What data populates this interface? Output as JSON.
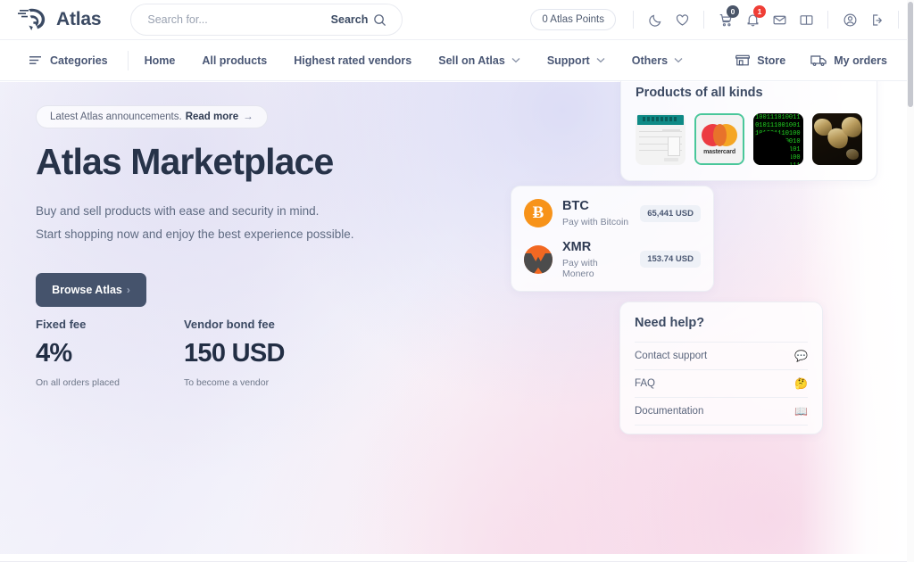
{
  "header": {
    "brand": "Atlas",
    "logo_icon": "eagle-head-logo",
    "search": {
      "placeholder": "Search for...",
      "value": "",
      "button_label": "Search",
      "icon": "search-icon"
    },
    "points_pill": "0 Atlas Points",
    "icons": [
      {
        "name": "dark-mode-icon",
        "glyph": "moon"
      },
      {
        "name": "wishlist-icon",
        "glyph": "heart"
      },
      {
        "name": "cart-icon",
        "glyph": "cart",
        "badge": "0",
        "badge_color": "#4a5568"
      },
      {
        "name": "notifications-icon",
        "glyph": "bell",
        "badge": "1",
        "badge_color": "#ef3e36"
      },
      {
        "name": "messages-icon",
        "glyph": "envelope"
      },
      {
        "name": "guides-icon",
        "glyph": "book"
      },
      {
        "name": "account-icon",
        "glyph": "user-circle"
      },
      {
        "name": "logout-icon",
        "glyph": "logout"
      }
    ]
  },
  "nav": {
    "categories": "Categories",
    "items": [
      {
        "label": "Home",
        "caret": false
      },
      {
        "label": "All products",
        "caret": false
      },
      {
        "label": "Highest rated vendors",
        "caret": false
      },
      {
        "label": "Sell on Atlas",
        "caret": true
      },
      {
        "label": "Support",
        "caret": true
      },
      {
        "label": "Others",
        "caret": true
      }
    ],
    "right": [
      {
        "label": "Store",
        "icon": "storefront-icon"
      },
      {
        "label": "My orders",
        "icon": "delivery-truck-icon"
      }
    ]
  },
  "hero": {
    "announcement": {
      "text": "Latest Atlas announcements.",
      "link": "Read more",
      "arrow": "→"
    },
    "title": "Atlas Marketplace",
    "line1": "Buy and sell products with ease and security in mind.",
    "line2": "Start shopping now and enjoy the best experience possible.",
    "cta": "Browse Atlas",
    "cta_arrow": "›"
  },
  "stats": [
    {
      "label": "Fixed fee",
      "value": "4%",
      "note": "On all orders placed"
    },
    {
      "label": "Vendor bond fee",
      "value": "150 USD",
      "note": "To become a vendor"
    }
  ],
  "products_card": {
    "title": "Products of all kinds",
    "thumbs": [
      {
        "name": "thumb-document",
        "alt": "scanned document form with teal header"
      },
      {
        "name": "thumb-mastercard",
        "alt": "mastercard logo",
        "caption": "mastercard"
      },
      {
        "name": "thumb-matrix-code",
        "alt": "green matrix binary code with hooded figure"
      },
      {
        "name": "thumb-gold-nuggets",
        "alt": "gold nuggets on dark background"
      }
    ],
    "matrix_code": "1001110100110101110010011010011101001101011100100110100111010011010111001001101001110100110101110010011010011101001101011100"
  },
  "crypto_card": {
    "rows": [
      {
        "symbol": "BTC",
        "desc": "Pay with Bitcoin",
        "price": "65,441 USD",
        "icon": "bitcoin-icon",
        "glyph": "Ƀ"
      },
      {
        "symbol": "XMR",
        "desc": "Pay with Monero",
        "price": "153.74 USD",
        "icon": "monero-icon"
      }
    ]
  },
  "help_card": {
    "title": "Need help?",
    "rows": [
      {
        "label": "Contact support",
        "emoji": "💬",
        "emoji_name": "speech-balloon-icon"
      },
      {
        "label": "FAQ",
        "emoji": "🤔",
        "emoji_name": "thinking-face-icon"
      },
      {
        "label": "Documentation",
        "emoji": "📖",
        "emoji_name": "open-book-icon"
      }
    ]
  },
  "colors": {
    "brand_dark": "#3b4a63",
    "cta": "#45536c",
    "badge_red": "#ef3e36",
    "btc_orange": "#f7931a",
    "xmr_orange": "#f26822",
    "mc_green": "#49c79a"
  }
}
